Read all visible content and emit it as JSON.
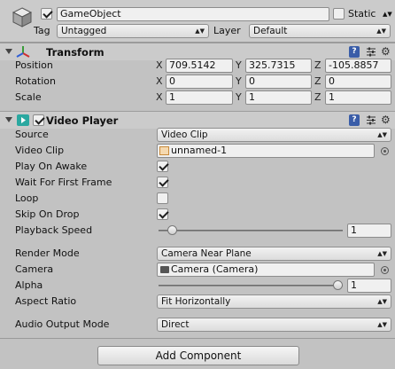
{
  "object": {
    "active": true,
    "name": "GameObject",
    "static_label": "Static",
    "static_checked": false,
    "tag_label": "Tag",
    "tag_value": "Untagged",
    "layer_label": "Layer",
    "layer_value": "Default"
  },
  "transform": {
    "title": "Transform",
    "position_label": "Position",
    "rotation_label": "Rotation",
    "scale_label": "Scale",
    "axis_x": "X",
    "axis_y": "Y",
    "axis_z": "Z",
    "position": {
      "x": "709.5142",
      "y": "325.7315",
      "z": "-105.8857"
    },
    "rotation": {
      "x": "0",
      "y": "0",
      "z": "0"
    },
    "scale": {
      "x": "1",
      "y": "1",
      "z": "1"
    }
  },
  "video_player": {
    "title": "Video Player",
    "enabled": true,
    "source_label": "Source",
    "source_value": "Video Clip",
    "video_clip_label": "Video Clip",
    "video_clip_value": "unnamed-1",
    "play_on_awake_label": "Play On Awake",
    "play_on_awake": true,
    "wait_first_frame_label": "Wait For First Frame",
    "wait_first_frame": true,
    "loop_label": "Loop",
    "loop": false,
    "skip_on_drop_label": "Skip On Drop",
    "skip_on_drop": true,
    "playback_speed_label": "Playback Speed",
    "playback_speed_value": "1",
    "playback_speed_fraction": 0.05,
    "render_mode_label": "Render Mode",
    "render_mode_value": "Camera Near Plane",
    "camera_label": "Camera",
    "camera_value": "Camera (Camera)",
    "alpha_label": "Alpha",
    "alpha_value": "1",
    "alpha_fraction": 1.0,
    "aspect_ratio_label": "Aspect Ratio",
    "aspect_ratio_value": "Fit Horizontally",
    "audio_output_label": "Audio Output Mode",
    "audio_output_value": "Direct"
  },
  "add_component_label": "Add Component",
  "dropdown_arrow": "▲▼"
}
